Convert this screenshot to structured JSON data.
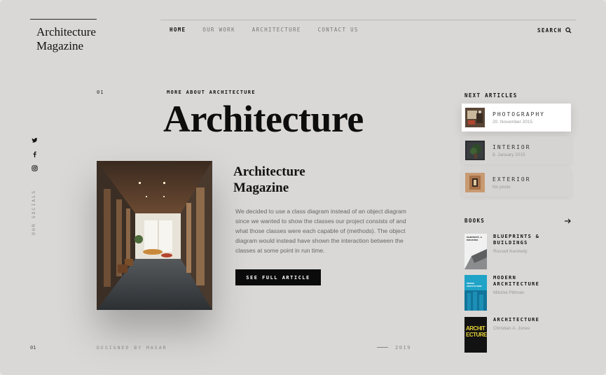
{
  "brand": {
    "line1": "Architecture",
    "line2": "Magazine"
  },
  "nav": [
    {
      "label": "HOME"
    },
    {
      "label": "OUR WORK"
    },
    {
      "label": "ARCHITECTURE"
    },
    {
      "label": "CONTACT US"
    }
  ],
  "search": {
    "label": "SEARCH"
  },
  "socials": {
    "label": "OUR SOCIALS",
    "icons": [
      "twitter-icon",
      "facebook-icon",
      "instagram-icon"
    ]
  },
  "hero": {
    "index": "01",
    "kicker": "MORE ABOUT ARCHITECTURE",
    "title": "Architecture"
  },
  "article": {
    "title_line1": "Architecture",
    "title_line2": "Magazine",
    "body": "We decided to use a class diagram instead of an object diagram since we wanted to show the classes our project consists of and what those classes were each capable of (methods). The object diagram would instead have shown the interaction between the classes at some point in run time.",
    "button": "SEE FULL ARTICLE"
  },
  "next_articles": {
    "title": "NEXT ARTICLES",
    "items": [
      {
        "name": "PHOTOGRAPHY",
        "date": "20. November 2015"
      },
      {
        "name": "INTERIOR",
        "date": "8. January 2015"
      },
      {
        "name": "EXTERIOR",
        "date": "No posts"
      }
    ]
  },
  "books": {
    "title": "BOOKS",
    "items": [
      {
        "title": "BLUEPRINTS & BUILDINGS",
        "author": "Russell Kennedy",
        "cover_text": "BLUEPRINTS & BUILDINGS"
      },
      {
        "title": "MODERN ARCHITECTURE",
        "author": "Mitchel Pittman",
        "cover_text": "MODERN ARCHITECTURE"
      },
      {
        "title": "ARCHITECTURE",
        "author": "Christian A. Jones",
        "cover_text": "ARCHIT ECTURE"
      }
    ]
  },
  "footer": {
    "index": "01",
    "designed": "DESIGNED BY MASAR",
    "year": "2019"
  },
  "colors": {
    "background": "#d9d8d6",
    "text": "#111111",
    "button": "#0b0b0b",
    "active_card": "#ffffff"
  }
}
